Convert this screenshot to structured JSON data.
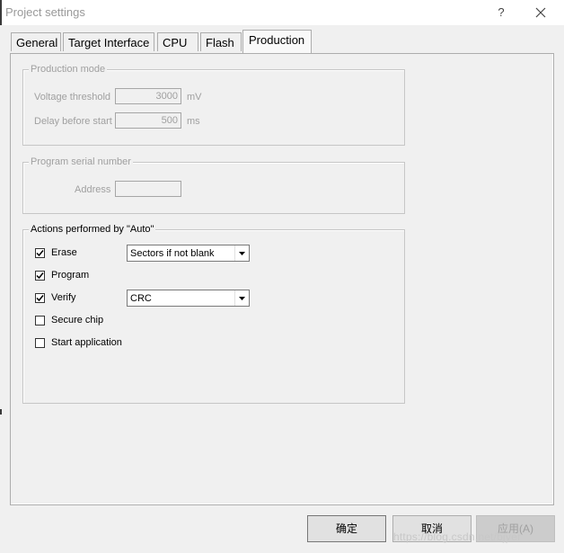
{
  "window": {
    "title": "Project settings",
    "help": "?"
  },
  "tabs": [
    {
      "label": "General"
    },
    {
      "label": "Target Interface"
    },
    {
      "label": "CPU"
    },
    {
      "label": "Flash"
    },
    {
      "label": "Production"
    }
  ],
  "production_mode": {
    "legend": "Production mode",
    "voltage_label": "Voltage threshold",
    "voltage_value": "3000",
    "voltage_unit": "mV",
    "delay_label": "Delay before start",
    "delay_value": "500",
    "delay_unit": "ms"
  },
  "serial_number": {
    "legend": "Program serial number",
    "address_label": "Address",
    "address_value": ""
  },
  "actions": {
    "legend": "Actions performed by \"Auto\"",
    "items": [
      {
        "label": "Erase",
        "checked": true
      },
      {
        "label": "Program",
        "checked": true
      },
      {
        "label": "Verify",
        "checked": true
      },
      {
        "label": "Secure chip",
        "checked": false
      },
      {
        "label": "Start application",
        "checked": false
      }
    ],
    "erase_select": "Sectors if not blank",
    "verify_select": "CRC"
  },
  "buttons": {
    "ok": "确定",
    "cancel": "取消",
    "apply": "应用(A)"
  },
  "watermark": "https://blog.csdn.net/bjyer"
}
